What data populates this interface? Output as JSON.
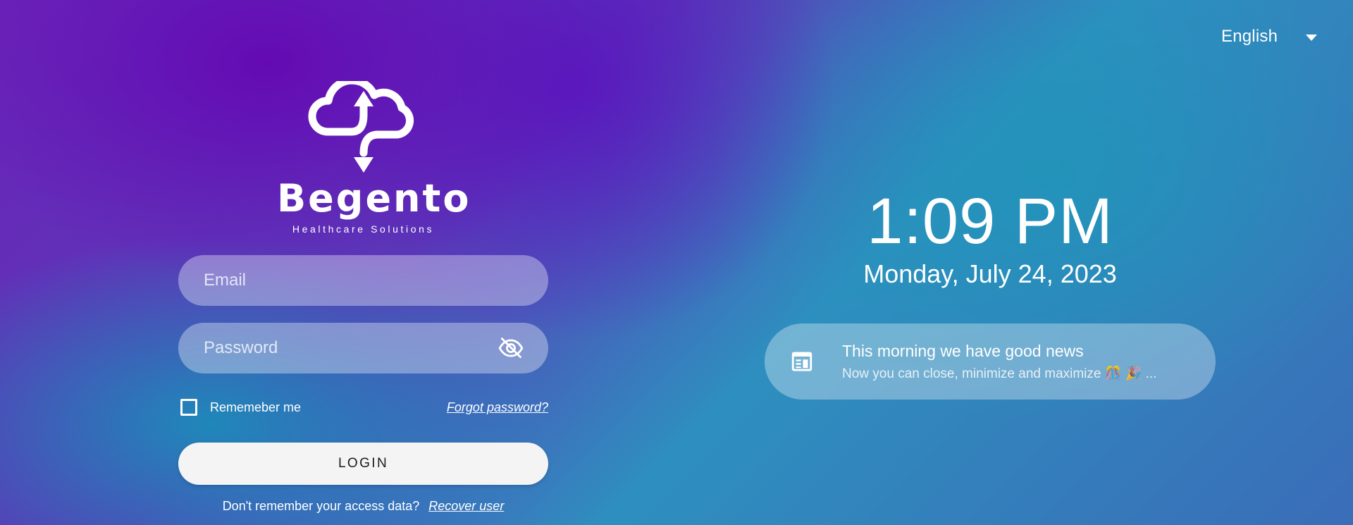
{
  "language": {
    "selected": "English"
  },
  "brand": {
    "name": "Begento",
    "tagline": "Healthcare Solutions"
  },
  "form": {
    "email_placeholder": "Email",
    "password_placeholder": "Password",
    "remember_label": "Rememeber me",
    "forgot_label": "Forgot password?",
    "login_label": "LOGIN",
    "recover_prompt": "Don't remember your access data?",
    "recover_link": "Recover user"
  },
  "clock": {
    "time": "1:09 PM",
    "date": "Monday, July 24, 2023"
  },
  "news": {
    "title": "This morning we have good news",
    "subtitle": "Now you can close, minimize and maximize 🎊 🎉 ..."
  },
  "icons": {
    "logo": "cloud-sync-icon",
    "password_toggle": "eye-off-icon",
    "news": "newspaper-icon",
    "language_caret": "caret-down-icon"
  }
}
